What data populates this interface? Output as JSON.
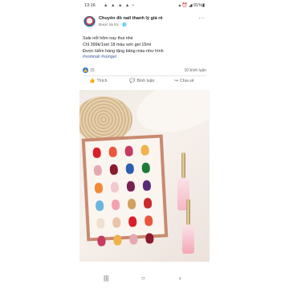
{
  "status_bar": {
    "time": "13:16",
    "left_icons": "▲ ▲ ▲ ▲ •",
    "right": "▴ ⏰ ◢ 91%▮"
  },
  "post": {
    "page_name": "Chuyên đồ nail thanh lý giá rẻ",
    "sponsored": "Được tài trợ · 🌐",
    "more_icon": "···",
    "caption": {
      "line1": "Sale nốt hôm nay thui nhé",
      "line2": "Chỉ 399k/1set 18 màu sơn gel 15ml",
      "line3": "Được kiểm hàng tặng bảng màu như hình",
      "hashtags": "#xomnail #songel"
    },
    "reactions": {
      "like_glyph": "👍",
      "count": "15",
      "comments": "10 bình luận"
    },
    "actions": {
      "like_icon": "👍",
      "like": "Thích",
      "comment_icon": "💬",
      "comment": "Bình luận",
      "share_icon": "↪",
      "share": "Chia sẻ"
    }
  },
  "photo": {
    "swatch_colors": [
      "#d8202a",
      "#e8573c",
      "#c73a62",
      "#f0b24a",
      "#e6a8b0",
      "#8a1a2e",
      "#2b5fb0",
      "#1e7a3a",
      "#f28a3a",
      "#f2c8cf",
      "#7a2050",
      "#5a2a7a",
      "#6bb6e0",
      "#f5a0b0",
      "#d0a060",
      "#c92a2a",
      "#f0e0d0",
      "#e9c4a8"
    ],
    "bottle_colors": [
      "#f5b8c4",
      "#f3a8b8"
    ]
  },
  "nav_bar": {
    "recents": "|||",
    "home": "○",
    "back": "‹"
  }
}
